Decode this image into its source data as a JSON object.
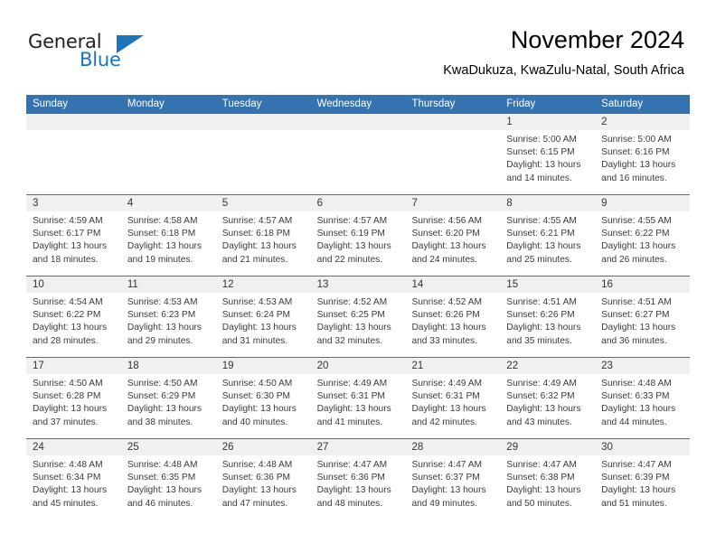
{
  "brand": {
    "name_part1": "General",
    "name_part2": "Blue",
    "accent_color": "#1b75bb",
    "text_color": "#231f20"
  },
  "header": {
    "title": "November 2024",
    "subtitle": "KwaDukuza, KwaZulu-Natal, South Africa"
  },
  "calendar": {
    "header_bg": "#3572b0",
    "datebar_bg": "#f0f0f0",
    "weekdays": [
      "Sunday",
      "Monday",
      "Tuesday",
      "Wednesday",
      "Thursday",
      "Friday",
      "Saturday"
    ],
    "weeks": [
      [
        {
          "day": "",
          "empty": true
        },
        {
          "day": "",
          "empty": true
        },
        {
          "day": "",
          "empty": true
        },
        {
          "day": "",
          "empty": true
        },
        {
          "day": "",
          "empty": true
        },
        {
          "day": "1",
          "sunrise": "Sunrise: 5:00 AM",
          "sunset": "Sunset: 6:15 PM",
          "daylight1": "Daylight: 13 hours",
          "daylight2": "and 14 minutes."
        },
        {
          "day": "2",
          "sunrise": "Sunrise: 5:00 AM",
          "sunset": "Sunset: 6:16 PM",
          "daylight1": "Daylight: 13 hours",
          "daylight2": "and 16 minutes."
        }
      ],
      [
        {
          "day": "3",
          "sunrise": "Sunrise: 4:59 AM",
          "sunset": "Sunset: 6:17 PM",
          "daylight1": "Daylight: 13 hours",
          "daylight2": "and 18 minutes."
        },
        {
          "day": "4",
          "sunrise": "Sunrise: 4:58 AM",
          "sunset": "Sunset: 6:18 PM",
          "daylight1": "Daylight: 13 hours",
          "daylight2": "and 19 minutes."
        },
        {
          "day": "5",
          "sunrise": "Sunrise: 4:57 AM",
          "sunset": "Sunset: 6:18 PM",
          "daylight1": "Daylight: 13 hours",
          "daylight2": "and 21 minutes."
        },
        {
          "day": "6",
          "sunrise": "Sunrise: 4:57 AM",
          "sunset": "Sunset: 6:19 PM",
          "daylight1": "Daylight: 13 hours",
          "daylight2": "and 22 minutes."
        },
        {
          "day": "7",
          "sunrise": "Sunrise: 4:56 AM",
          "sunset": "Sunset: 6:20 PM",
          "daylight1": "Daylight: 13 hours",
          "daylight2": "and 24 minutes."
        },
        {
          "day": "8",
          "sunrise": "Sunrise: 4:55 AM",
          "sunset": "Sunset: 6:21 PM",
          "daylight1": "Daylight: 13 hours",
          "daylight2": "and 25 minutes."
        },
        {
          "day": "9",
          "sunrise": "Sunrise: 4:55 AM",
          "sunset": "Sunset: 6:22 PM",
          "daylight1": "Daylight: 13 hours",
          "daylight2": "and 26 minutes."
        }
      ],
      [
        {
          "day": "10",
          "sunrise": "Sunrise: 4:54 AM",
          "sunset": "Sunset: 6:22 PM",
          "daylight1": "Daylight: 13 hours",
          "daylight2": "and 28 minutes."
        },
        {
          "day": "11",
          "sunrise": "Sunrise: 4:53 AM",
          "sunset": "Sunset: 6:23 PM",
          "daylight1": "Daylight: 13 hours",
          "daylight2": "and 29 minutes."
        },
        {
          "day": "12",
          "sunrise": "Sunrise: 4:53 AM",
          "sunset": "Sunset: 6:24 PM",
          "daylight1": "Daylight: 13 hours",
          "daylight2": "and 31 minutes."
        },
        {
          "day": "13",
          "sunrise": "Sunrise: 4:52 AM",
          "sunset": "Sunset: 6:25 PM",
          "daylight1": "Daylight: 13 hours",
          "daylight2": "and 32 minutes."
        },
        {
          "day": "14",
          "sunrise": "Sunrise: 4:52 AM",
          "sunset": "Sunset: 6:26 PM",
          "daylight1": "Daylight: 13 hours",
          "daylight2": "and 33 minutes."
        },
        {
          "day": "15",
          "sunrise": "Sunrise: 4:51 AM",
          "sunset": "Sunset: 6:26 PM",
          "daylight1": "Daylight: 13 hours",
          "daylight2": "and 35 minutes."
        },
        {
          "day": "16",
          "sunrise": "Sunrise: 4:51 AM",
          "sunset": "Sunset: 6:27 PM",
          "daylight1": "Daylight: 13 hours",
          "daylight2": "and 36 minutes."
        }
      ],
      [
        {
          "day": "17",
          "sunrise": "Sunrise: 4:50 AM",
          "sunset": "Sunset: 6:28 PM",
          "daylight1": "Daylight: 13 hours",
          "daylight2": "and 37 minutes."
        },
        {
          "day": "18",
          "sunrise": "Sunrise: 4:50 AM",
          "sunset": "Sunset: 6:29 PM",
          "daylight1": "Daylight: 13 hours",
          "daylight2": "and 38 minutes."
        },
        {
          "day": "19",
          "sunrise": "Sunrise: 4:50 AM",
          "sunset": "Sunset: 6:30 PM",
          "daylight1": "Daylight: 13 hours",
          "daylight2": "and 40 minutes."
        },
        {
          "day": "20",
          "sunrise": "Sunrise: 4:49 AM",
          "sunset": "Sunset: 6:31 PM",
          "daylight1": "Daylight: 13 hours",
          "daylight2": "and 41 minutes."
        },
        {
          "day": "21",
          "sunrise": "Sunrise: 4:49 AM",
          "sunset": "Sunset: 6:31 PM",
          "daylight1": "Daylight: 13 hours",
          "daylight2": "and 42 minutes."
        },
        {
          "day": "22",
          "sunrise": "Sunrise: 4:49 AM",
          "sunset": "Sunset: 6:32 PM",
          "daylight1": "Daylight: 13 hours",
          "daylight2": "and 43 minutes."
        },
        {
          "day": "23",
          "sunrise": "Sunrise: 4:48 AM",
          "sunset": "Sunset: 6:33 PM",
          "daylight1": "Daylight: 13 hours",
          "daylight2": "and 44 minutes."
        }
      ],
      [
        {
          "day": "24",
          "sunrise": "Sunrise: 4:48 AM",
          "sunset": "Sunset: 6:34 PM",
          "daylight1": "Daylight: 13 hours",
          "daylight2": "and 45 minutes."
        },
        {
          "day": "25",
          "sunrise": "Sunrise: 4:48 AM",
          "sunset": "Sunset: 6:35 PM",
          "daylight1": "Daylight: 13 hours",
          "daylight2": "and 46 minutes."
        },
        {
          "day": "26",
          "sunrise": "Sunrise: 4:48 AM",
          "sunset": "Sunset: 6:36 PM",
          "daylight1": "Daylight: 13 hours",
          "daylight2": "and 47 minutes."
        },
        {
          "day": "27",
          "sunrise": "Sunrise: 4:47 AM",
          "sunset": "Sunset: 6:36 PM",
          "daylight1": "Daylight: 13 hours",
          "daylight2": "and 48 minutes."
        },
        {
          "day": "28",
          "sunrise": "Sunrise: 4:47 AM",
          "sunset": "Sunset: 6:37 PM",
          "daylight1": "Daylight: 13 hours",
          "daylight2": "and 49 minutes."
        },
        {
          "day": "29",
          "sunrise": "Sunrise: 4:47 AM",
          "sunset": "Sunset: 6:38 PM",
          "daylight1": "Daylight: 13 hours",
          "daylight2": "and 50 minutes."
        },
        {
          "day": "30",
          "sunrise": "Sunrise: 4:47 AM",
          "sunset": "Sunset: 6:39 PM",
          "daylight1": "Daylight: 13 hours",
          "daylight2": "and 51 minutes."
        }
      ]
    ]
  }
}
